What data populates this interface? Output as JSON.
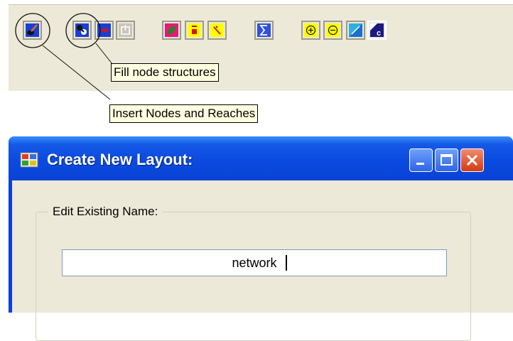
{
  "toolbar": {
    "tooltips": {
      "fill_node_structures": "Fill node structures",
      "insert_nodes_and_reaches": "Insert Nodes and Reaches"
    },
    "buttons": [
      {
        "name": "insert-nodes-reaches-button",
        "icon": "brush-icon"
      },
      {
        "name": "fill-node-structures-button",
        "icon": "node-fill-icon"
      },
      {
        "name": "arrow-right-button",
        "icon": "red-arrow-icon"
      },
      {
        "name": "disabled-tool-button",
        "icon": "gray-upload-icon"
      },
      {
        "name": "leaf-tool-button",
        "icon": "leaf-icon"
      },
      {
        "name": "marker-tool-button",
        "icon": "marker-icon"
      },
      {
        "name": "slash-tool-button",
        "icon": "slash-icon"
      },
      {
        "name": "sum-button",
        "icon": "sigma-icon"
      },
      {
        "name": "zoom-in-button",
        "icon": "zoom-in-icon"
      },
      {
        "name": "zoom-out-button",
        "icon": "zoom-out-icon"
      },
      {
        "name": "fit-view-button",
        "icon": "fit-view-icon"
      },
      {
        "name": "layout-c-button",
        "icon": "layout-c-icon"
      }
    ]
  },
  "dialog": {
    "title": "Create New Layout:",
    "group_label": "Edit Existing Name:",
    "name_value": "network"
  }
}
